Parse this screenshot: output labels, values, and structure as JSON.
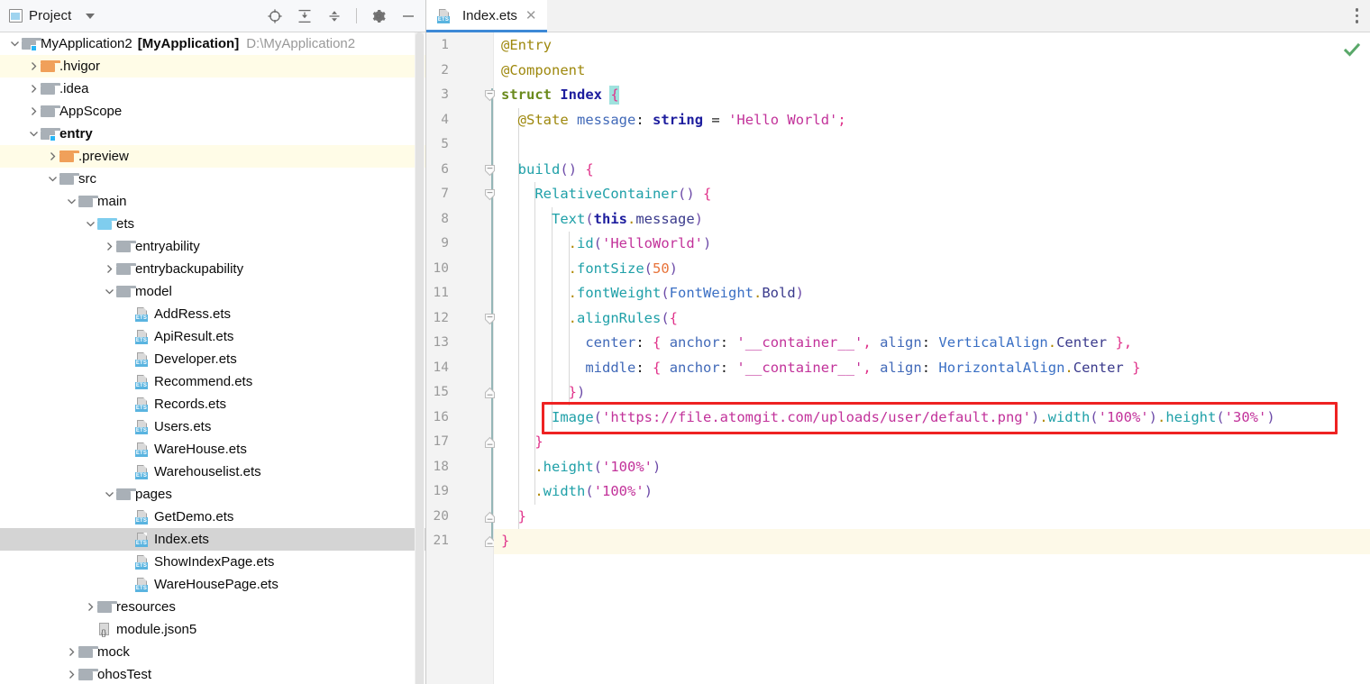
{
  "sidebar": {
    "header": {
      "title": "Project",
      "project_icon": "project-window-icon",
      "dropdown_icon": "chevron-down-icon",
      "tools": [
        {
          "name": "select-opened-file-icon",
          "label": "Select Opened File"
        },
        {
          "name": "expand-all-icon",
          "label": "Expand All"
        },
        {
          "name": "collapse-all-icon",
          "label": "Collapse All"
        },
        {
          "name": "settings-gear-icon",
          "label": "Settings"
        },
        {
          "name": "hide-panel-icon",
          "label": "Hide"
        }
      ]
    },
    "tree": [
      {
        "depth": 0,
        "label": "MyApplication2",
        "label_bold_part": "[MyApplication]",
        "path": "D:\\MyApplication2",
        "icon": "module-folder-icon",
        "arrow": "expanded",
        "state": "normal"
      },
      {
        "depth": 1,
        "label": ".hvigor",
        "icon": "folder-orange-icon",
        "arrow": "collapsed",
        "state": "ignored"
      },
      {
        "depth": 1,
        "label": ".idea",
        "icon": "folder-gray-icon",
        "arrow": "collapsed",
        "state": "normal"
      },
      {
        "depth": 1,
        "label": "AppScope",
        "icon": "folder-gray-icon",
        "arrow": "collapsed",
        "state": "normal"
      },
      {
        "depth": 1,
        "label": "entry",
        "icon": "module-folder-icon",
        "arrow": "expanded",
        "state": "bold"
      },
      {
        "depth": 2,
        "label": ".preview",
        "icon": "folder-orange-icon",
        "arrow": "collapsed",
        "state": "ignored"
      },
      {
        "depth": 2,
        "label": "src",
        "icon": "folder-gray-icon",
        "arrow": "expanded",
        "state": "normal"
      },
      {
        "depth": 3,
        "label": "main",
        "icon": "folder-gray-icon",
        "arrow": "expanded",
        "state": "normal"
      },
      {
        "depth": 4,
        "label": "ets",
        "icon": "folder-blue-icon",
        "arrow": "expanded",
        "state": "normal"
      },
      {
        "depth": 5,
        "label": "entryability",
        "icon": "folder-gray-icon",
        "arrow": "collapsed",
        "state": "normal"
      },
      {
        "depth": 5,
        "label": "entrybackupability",
        "icon": "folder-gray-icon",
        "arrow": "collapsed",
        "state": "normal"
      },
      {
        "depth": 5,
        "label": "model",
        "icon": "folder-gray-icon",
        "arrow": "expanded",
        "state": "normal"
      },
      {
        "depth": 6,
        "label": "AddRess.ets",
        "icon": "ets-file-icon",
        "arrow": "none",
        "state": "normal"
      },
      {
        "depth": 6,
        "label": "ApiResult.ets",
        "icon": "ets-file-icon",
        "arrow": "none",
        "state": "normal"
      },
      {
        "depth": 6,
        "label": "Developer.ets",
        "icon": "ets-file-icon",
        "arrow": "none",
        "state": "normal"
      },
      {
        "depth": 6,
        "label": "Recommend.ets",
        "icon": "ets-file-icon",
        "arrow": "none",
        "state": "normal"
      },
      {
        "depth": 6,
        "label": "Records.ets",
        "icon": "ets-file-icon",
        "arrow": "none",
        "state": "normal"
      },
      {
        "depth": 6,
        "label": "Users.ets",
        "icon": "ets-file-icon",
        "arrow": "none",
        "state": "normal"
      },
      {
        "depth": 6,
        "label": "WareHouse.ets",
        "icon": "ets-file-icon",
        "arrow": "none",
        "state": "normal"
      },
      {
        "depth": 6,
        "label": "Warehouselist.ets",
        "icon": "ets-file-icon",
        "arrow": "none",
        "state": "normal"
      },
      {
        "depth": 5,
        "label": "pages",
        "icon": "folder-gray-icon",
        "arrow": "expanded",
        "state": "normal"
      },
      {
        "depth": 6,
        "label": "GetDemo.ets",
        "icon": "ets-file-icon",
        "arrow": "none",
        "state": "normal"
      },
      {
        "depth": 6,
        "label": "Index.ets",
        "icon": "ets-file-icon",
        "arrow": "none",
        "state": "selected"
      },
      {
        "depth": 6,
        "label": "ShowIndexPage.ets",
        "icon": "ets-file-icon",
        "arrow": "none",
        "state": "normal"
      },
      {
        "depth": 6,
        "label": "WareHousePage.ets",
        "icon": "ets-file-icon",
        "arrow": "none",
        "state": "normal"
      },
      {
        "depth": 4,
        "label": "resources",
        "icon": "folder-gray-icon",
        "arrow": "collapsed",
        "state": "normal"
      },
      {
        "depth": 4,
        "label": "module.json5",
        "icon": "json5-file-icon",
        "arrow": "none",
        "state": "normal"
      },
      {
        "depth": 3,
        "label": "mock",
        "icon": "folder-gray-icon",
        "arrow": "collapsed",
        "state": "normal"
      },
      {
        "depth": 3,
        "label": "ohosTest",
        "icon": "folder-gray-icon",
        "arrow": "collapsed",
        "state": "normal"
      }
    ]
  },
  "editor": {
    "tabs": [
      {
        "label": "Index.ets",
        "icon": "ets-file-icon",
        "active": true,
        "close_icon": "close-icon"
      }
    ],
    "more_menu_icon": "vertical-ellipsis-icon",
    "inspection_status_icon": "check-mark-icon",
    "inspection_status_color": "#59a869",
    "highlight_box_color": "#ee2222",
    "highlight_box_line": 16,
    "current_line": 21,
    "line_numbers": [
      1,
      2,
      3,
      4,
      5,
      6,
      7,
      8,
      9,
      10,
      11,
      12,
      13,
      14,
      15,
      16,
      17,
      18,
      19,
      20,
      21
    ],
    "code_lines": [
      {
        "n": 1,
        "text": "@Entry"
      },
      {
        "n": 2,
        "text": "@Component"
      },
      {
        "n": 3,
        "text": "struct Index {"
      },
      {
        "n": 4,
        "text": "  @State message: string = 'Hello World';"
      },
      {
        "n": 5,
        "text": ""
      },
      {
        "n": 6,
        "text": "  build() {"
      },
      {
        "n": 7,
        "text": "    RelativeContainer() {"
      },
      {
        "n": 8,
        "text": "      Text(this.message)"
      },
      {
        "n": 9,
        "text": "        .id('HelloWorld')"
      },
      {
        "n": 10,
        "text": "        .fontSize(50)"
      },
      {
        "n": 11,
        "text": "        .fontWeight(FontWeight.Bold)"
      },
      {
        "n": 12,
        "text": "        .alignRules({"
      },
      {
        "n": 13,
        "text": "          center: { anchor: '__container__', align: VerticalAlign.Center },"
      },
      {
        "n": 14,
        "text": "          middle: { anchor: '__container__', align: HorizontalAlign.Center }"
      },
      {
        "n": 15,
        "text": "        })"
      },
      {
        "n": 16,
        "text": "      Image('https://file.atomgit.com/uploads/user/default.png').width('100%').height('30%')"
      },
      {
        "n": 17,
        "text": "    }"
      },
      {
        "n": 18,
        "text": "    .height('100%')"
      },
      {
        "n": 19,
        "text": "    .width('100%')"
      },
      {
        "n": 20,
        "text": "  }"
      },
      {
        "n": 21,
        "text": "}"
      }
    ],
    "fold_markers": [
      {
        "line": 3,
        "kind": "expanded"
      },
      {
        "line": 6,
        "kind": "expanded"
      },
      {
        "line": 7,
        "kind": "expanded"
      },
      {
        "line": 12,
        "kind": "expanded"
      },
      {
        "line": 15,
        "kind": "end"
      },
      {
        "line": 17,
        "kind": "end"
      },
      {
        "line": 20,
        "kind": "end"
      },
      {
        "line": 21,
        "kind": "end"
      }
    ]
  }
}
